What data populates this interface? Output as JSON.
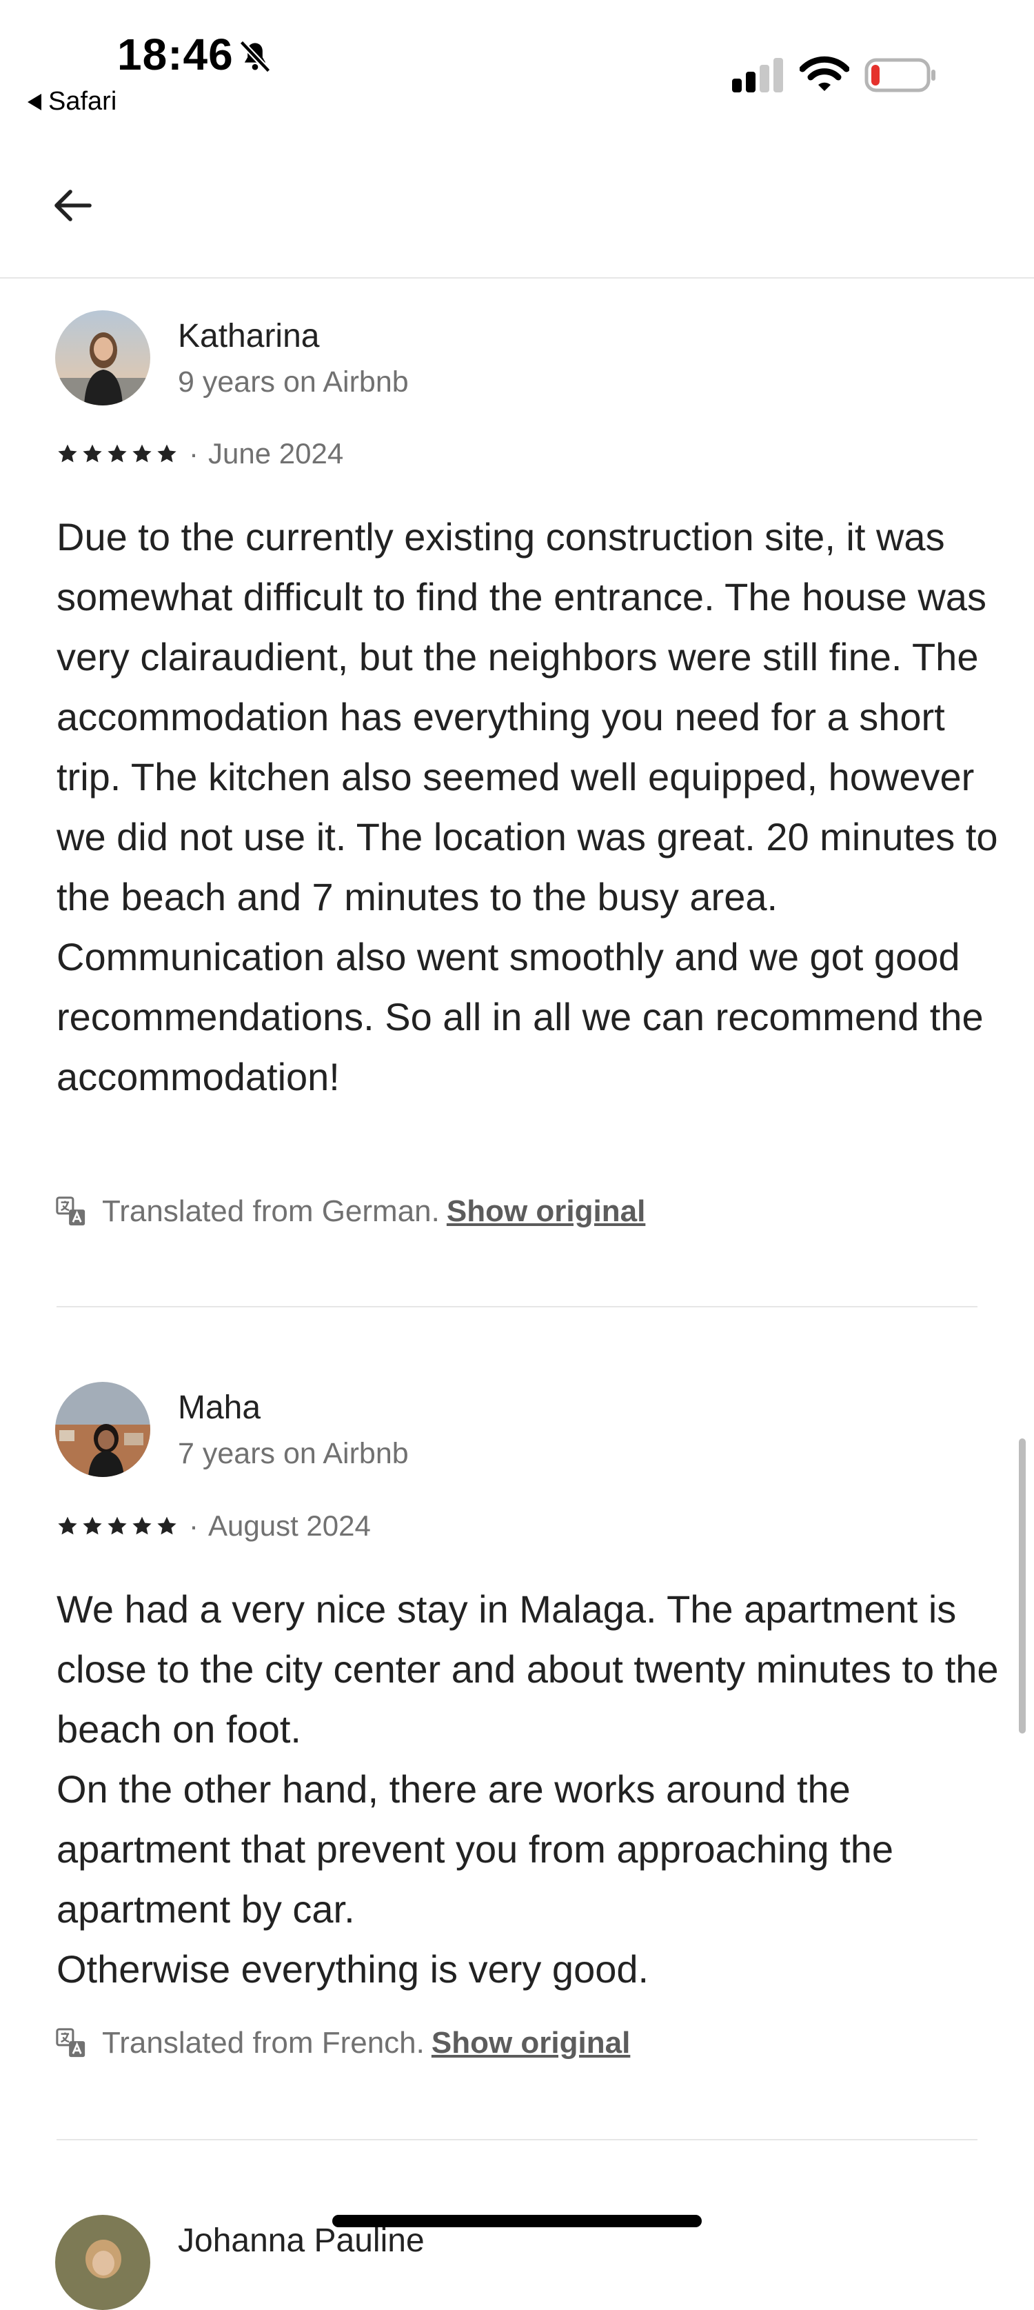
{
  "status_bar": {
    "time": "18:46",
    "back_app": "Safari"
  },
  "reviews": [
    {
      "name": "Katharina",
      "tenure": "9 years on Airbnb",
      "stars": 5,
      "date": "June 2024",
      "body": [
        "Due to the currently existing construction site, it was somewhat difficult to find the entrance. The house was very clairaudient, but the neighbors were still fine. The accommodation has everything you need for a short trip. The kitchen also seemed well equipped, however we did not use it. The location was great. 20 minutes to the beach and 7 minutes to the busy area. Communication also went smoothly and we got good recommendations. So all in all we can recommend the accommodation!"
      ],
      "translated_note": "Translated from German.",
      "show_original": "Show original"
    },
    {
      "name": "Maha",
      "tenure": "7 years on Airbnb",
      "stars": 5,
      "date": "August 2024",
      "body": [
        "We had a very nice stay in Malaga. The apartment is close to the city center and about twenty minutes to the beach on foot.",
        "On the other hand, there are works around the apartment that prevent you from approaching the apartment by car.",
        "Otherwise everything is very good."
      ],
      "translated_note": "Translated from French.",
      "show_original": "Show original"
    },
    {
      "name": "Johanna Pauline"
    }
  ],
  "colors": {
    "text": "#222222",
    "secondary": "#717171",
    "divider": "#e6e6e6",
    "battery_low": "#e5322d"
  },
  "icons": {
    "back": "arrow-left-icon",
    "bell": "bell-slash-icon",
    "translate": "translate-icon",
    "star": "star-icon"
  }
}
